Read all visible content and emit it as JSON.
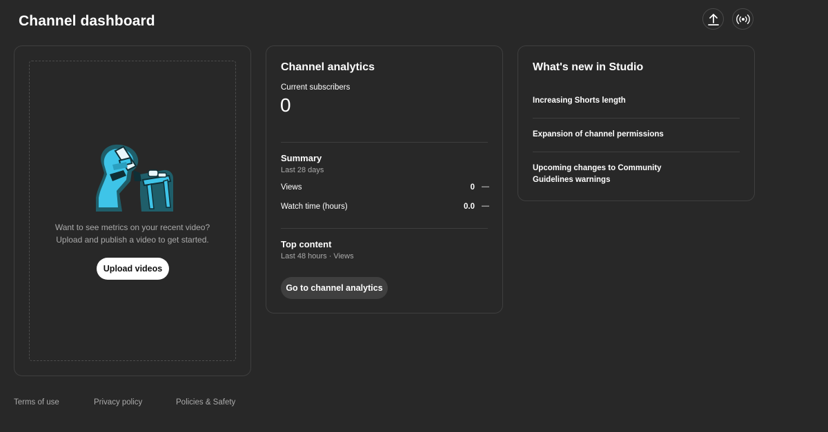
{
  "header": {
    "title": "Channel dashboard",
    "icons": [
      "upload-icon",
      "live-icon"
    ]
  },
  "video_card": {
    "prompt_line1": "Want to see metrics on your recent video?",
    "prompt_line2": "Upload and publish a video to get started.",
    "upload_button": "Upload videos",
    "illustration_color": "#3ec4e8"
  },
  "analytics": {
    "title": "Channel analytics",
    "subscribers_label": "Current subscribers",
    "subscribers_value": "0",
    "summary": {
      "title": "Summary",
      "period": "Last 28 days",
      "metrics": [
        {
          "label": "Views",
          "value": "0",
          "trend": "—"
        },
        {
          "label": "Watch time (hours)",
          "value": "0.0",
          "trend": "—"
        }
      ]
    },
    "top_content": {
      "title": "Top content",
      "period": "Last 48 hours · Views"
    },
    "button": "Go to channel analytics"
  },
  "whats_new": {
    "title": "What's new in Studio",
    "items": [
      "Increasing Shorts length",
      "Expansion of channel permissions",
      "Upcoming changes to Community Guidelines warnings"
    ]
  },
  "footer": {
    "links": [
      "Terms of use",
      "Privacy policy",
      "Policies & Safety"
    ]
  },
  "colors": {
    "background": "#282828",
    "card_border": "#3f3f3f",
    "secondary_text": "#aaaaaa",
    "accent_cyan": "#3ec4e8"
  }
}
